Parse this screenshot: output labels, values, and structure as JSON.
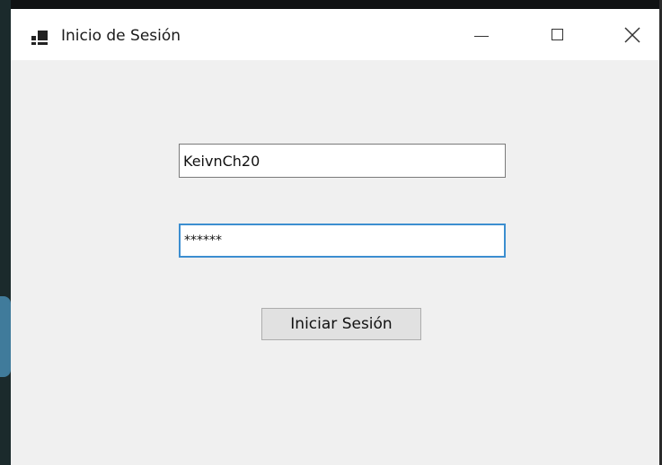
{
  "window": {
    "title": "Inicio de Sesión",
    "icon": "app-window-icon",
    "controls": {
      "minimize_icon": "minimize-icon",
      "maximize_icon": "maximize-icon",
      "close_icon": "close-icon"
    }
  },
  "form": {
    "username_value": "KeivnCh20",
    "password_masked": "******",
    "login_label": "Iniciar Sesión"
  },
  "colors": {
    "window_bg": "#f0f0f0",
    "titlebar_bg": "#ffffff",
    "focus_border": "#3c8ed0",
    "button_bg": "#e1e1e1"
  }
}
